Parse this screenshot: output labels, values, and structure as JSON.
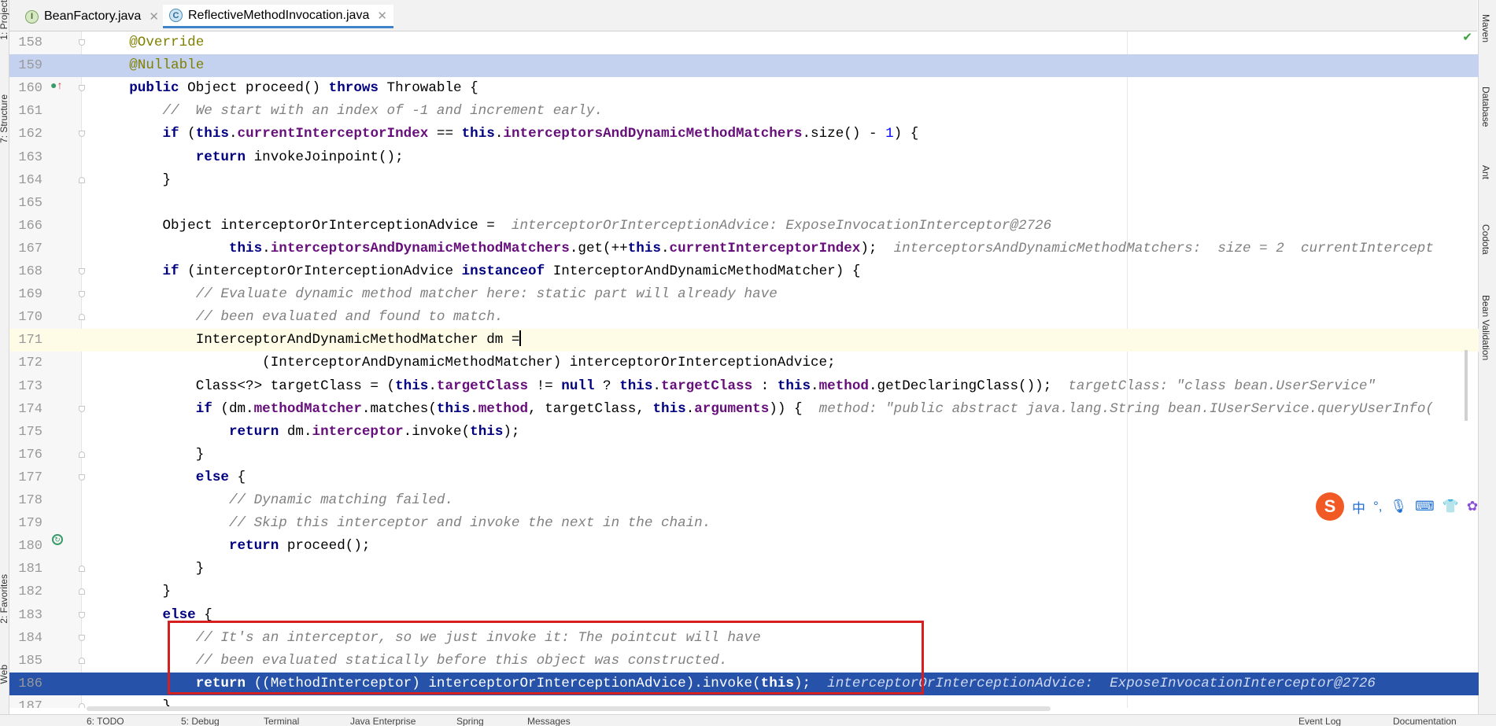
{
  "tabs": [
    {
      "label": "BeanFactory.java",
      "icon": "interface-icon",
      "icon_letter": "I",
      "active": false
    },
    {
      "label": "ReflectiveMethodInvocation.java",
      "icon": "class-icon",
      "icon_letter": "C",
      "active": true
    }
  ],
  "left_toolbar": [
    "1: Project",
    "7: Structure",
    "2: Favorites",
    "Web"
  ],
  "right_toolbar": [
    "Maven",
    "Database",
    "Ant",
    "Codota",
    "Bean Validation"
  ],
  "ime": {
    "logo": "S",
    "items": [
      "中",
      "°,",
      "mic",
      "keyboard",
      "shirt",
      "apps"
    ]
  },
  "bottom_toolbar": [
    "6: TODO",
    "5: Debug",
    "Terminal",
    "Java Enterprise",
    "Spring",
    "Messages",
    "Event Log",
    "Documentation"
  ],
  "colors": {
    "selection": "#c5d2ef",
    "current_line": "#fefbe6",
    "execution_line": "#2652aa",
    "annotation_box": "#d62020",
    "active_tab": "#4083c9"
  },
  "lines": [
    {
      "n": "158",
      "html": "    <span class=\"ann\">@Override</span>"
    },
    {
      "n": "159",
      "html": "    <span class=\"ann\">@Nullable</span>"
    },
    {
      "n": "160",
      "html": "    <span class=\"kw\">public</span> Object proceed() <span class=\"kw\">throws</span> Throwable {"
    },
    {
      "n": "161",
      "html": "        <span class=\"cmt\">//  We start with an index of -1 and increment early.</span>"
    },
    {
      "n": "162",
      "html": "        <span class=\"kw\">if</span> (<span class=\"kw\">this</span>.<span class=\"fld\">currentInterceptorIndex</span> == <span class=\"kw\">this</span>.<span class=\"fld\">interceptorsAndDynamicMethodMatchers</span>.size() - <span class=\"num\">1</span>) {"
    },
    {
      "n": "163",
      "html": "            <span class=\"kw\">return</span> invokeJoinpoint();"
    },
    {
      "n": "164",
      "html": "        }"
    },
    {
      "n": "165",
      "html": ""
    },
    {
      "n": "166",
      "html": "        Object interceptorOrInterceptionAdvice =  <span class=\"hint\">interceptorOrInterceptionAdvice: ExposeInvocationInterceptor@2726</span>"
    },
    {
      "n": "167",
      "html": "                <span class=\"kw\">this</span>.<span class=\"fld\">interceptorsAndDynamicMethodMatchers</span>.get(++<span class=\"kw\">this</span>.<span class=\"fld\">currentInterceptorIndex</span>);  <span class=\"hint\">interceptorsAndDynamicMethodMatchers:  size = 2  currentIntercept</span>"
    },
    {
      "n": "168",
      "html": "        <span class=\"kw\">if</span> (interceptorOrInterceptionAdvice <span class=\"kw\">instanceof</span> InterceptorAndDynamicMethodMatcher) {"
    },
    {
      "n": "169",
      "html": "            <span class=\"cmt\">// Evaluate dynamic method matcher here: static part will already have</span>"
    },
    {
      "n": "170",
      "html": "            <span class=\"cmt\">// been evaluated and found to match.</span>"
    },
    {
      "n": "171",
      "html": "            InterceptorAndDynamicMethodMatcher dm =<span class=\"caret\"></span>"
    },
    {
      "n": "172",
      "html": "                    (InterceptorAndDynamicMethodMatcher) interceptorOrInterceptionAdvice;"
    },
    {
      "n": "173",
      "html": "            Class&lt;?&gt; targetClass = (<span class=\"kw\">this</span>.<span class=\"fld\">targetClass</span> != <span class=\"kw\">null</span> ? <span class=\"kw\">this</span>.<span class=\"fld\">targetClass</span> : <span class=\"kw\">this</span>.<span class=\"fld\">method</span>.getDeclaringClass());  <span class=\"hint\">targetClass: \"class bean.UserService\"</span>"
    },
    {
      "n": "174",
      "html": "            <span class=\"kw\">if</span> (dm.<span class=\"fld\">methodMatcher</span>.matches(<span class=\"kw\">this</span>.<span class=\"fld\">method</span>, targetClass, <span class=\"kw\">this</span>.<span class=\"fld\">arguments</span>)) {  <span class=\"hint\">method: \"public abstract java.lang.String bean.IUserService.queryUserInfo(</span>"
    },
    {
      "n": "175",
      "html": "                <span class=\"kw\">return</span> dm.<span class=\"fld\">interceptor</span>.invoke(<span class=\"kw\">this</span>);"
    },
    {
      "n": "176",
      "html": "            }"
    },
    {
      "n": "177",
      "html": "            <span class=\"kw\">else</span> {"
    },
    {
      "n": "178",
      "html": "                <span class=\"cmt\">// Dynamic matching failed.</span>"
    },
    {
      "n": "179",
      "html": "                <span class=\"cmt\">// Skip this interceptor and invoke the next in the chain.</span>"
    },
    {
      "n": "180",
      "html": "                <span class=\"kw\">return</span> proceed();"
    },
    {
      "n": "181",
      "html": "            }"
    },
    {
      "n": "182",
      "html": "        }"
    },
    {
      "n": "183",
      "html": "        <span class=\"kw\">else</span> {"
    },
    {
      "n": "184",
      "html": "            <span class=\"cmt\">// It's an interceptor, so we just invoke it: The pointcut will have</span>"
    },
    {
      "n": "185",
      "html": "            <span class=\"cmt\">// been evaluated statically before this object was constructed.</span>"
    },
    {
      "n": "186",
      "html": "            <span class=\"kw\">return</span> ((MethodInterceptor) interceptorOrInterceptionAdvice).invoke(<span class=\"kw\">this</span>);  <span class=\"hint\">interceptorOrInterceptionAdvice:  ExposeInvocationInterceptor@2726</span>"
    },
    {
      "n": "187",
      "html": "        }"
    }
  ]
}
